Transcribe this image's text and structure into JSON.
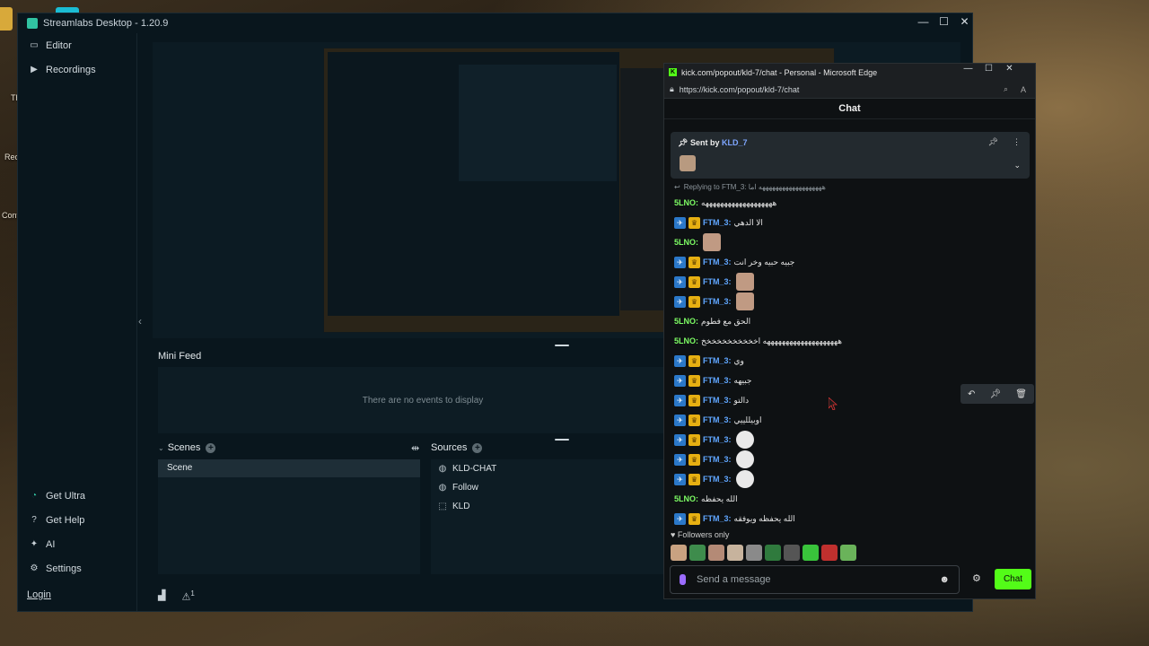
{
  "desktop": {
    "labels": [
      "Th",
      "Rec",
      "Cont"
    ]
  },
  "streamlabs": {
    "title": "Streamlabs Desktop - 1.20.9",
    "nav_top": [
      {
        "label": "Editor",
        "icon": "monitor-icon"
      },
      {
        "label": "Recordings",
        "icon": "play-circle-icon"
      }
    ],
    "nav_bottom": [
      {
        "label": "Get Ultra",
        "icon": "ultra-icon"
      },
      {
        "label": "Get Help",
        "icon": "help-icon"
      },
      {
        "label": "AI",
        "icon": "sparkle-icon"
      },
      {
        "label": "Settings",
        "icon": "gear-icon"
      }
    ],
    "login": "Login",
    "mini_feed": {
      "title": "Mini Feed",
      "empty": "There are no events to display"
    },
    "scenes": {
      "title": "Scenes",
      "items": [
        "Scene"
      ]
    },
    "sources": {
      "title": "Sources",
      "items": [
        {
          "label": "KLD-CHAT",
          "icon": "globe-icon"
        },
        {
          "label": "Follow",
          "icon": "globe-icon"
        },
        {
          "label": "KLD",
          "icon": "capture-icon"
        }
      ]
    },
    "footer": {
      "alert_count": "1"
    }
  },
  "edge": {
    "title": "kick.com/popout/kld-7/chat - Personal - Microsoft Edge",
    "url": "https://kick.com/popout/kld-7/chat",
    "chat_title": "Chat",
    "pinned": {
      "prefix": "Sent by",
      "user": "KLD_7"
    },
    "reply_to": "Replying to FTM_3: هههههههههههههههههههه اما",
    "messages": [
      {
        "user": "5LNO:",
        "color": "green",
        "badges": false,
        "text": "هههههههههههههههههههه",
        "emote": ""
      },
      {
        "user": "FTM_3:",
        "color": "blue",
        "badges": true,
        "text": "الا الدهي",
        "emote": ""
      },
      {
        "user": "5LNO:",
        "color": "green",
        "badges": false,
        "text": "",
        "emote": "square"
      },
      {
        "user": "FTM_3:",
        "color": "blue",
        "badges": true,
        "text": "جبيه حبيه وخر انت",
        "emote": ""
      },
      {
        "user": "FTM_3:",
        "color": "blue",
        "badges": true,
        "text": "",
        "emote": "square"
      },
      {
        "user": "FTM_3:",
        "color": "blue",
        "badges": true,
        "text": "",
        "emote": "square"
      },
      {
        "user": "5LNO:",
        "color": "green",
        "badges": false,
        "text": "الحق مع فطوم",
        "emote": ""
      },
      {
        "user": "5LNO:",
        "color": "green",
        "badges": false,
        "text": "ههههههههههههههههههههه اخخخخخخخخخخخ",
        "emote": ""
      },
      {
        "user": "FTM_3:",
        "color": "blue",
        "badges": true,
        "text": "وي",
        "emote": ""
      },
      {
        "user": "FTM_3:",
        "color": "blue",
        "badges": true,
        "text": "جبيهه",
        "emote": ""
      },
      {
        "user": "FTM_3:",
        "color": "blue",
        "badges": true,
        "text": "دالتو",
        "emote": ""
      },
      {
        "user": "FTM_3:",
        "color": "blue",
        "badges": true,
        "text": "اوبيللييي",
        "emote": ""
      },
      {
        "user": "FTM_3:",
        "color": "blue",
        "badges": true,
        "text": "",
        "emote": "round"
      },
      {
        "user": "FTM_3:",
        "color": "blue",
        "badges": true,
        "text": "",
        "emote": "round"
      },
      {
        "user": "FTM_3:",
        "color": "blue",
        "badges": true,
        "text": "",
        "emote": "round"
      },
      {
        "user": "5LNO:",
        "color": "green",
        "badges": false,
        "text": "الله يحفظه",
        "emote": ""
      },
      {
        "user": "FTM_3:",
        "color": "blue",
        "badges": true,
        "text": "الله يحفظه ويوفقه",
        "emote": ""
      }
    ],
    "followers_only": "Followers only",
    "input_placeholder": "Send a message",
    "chat_button": "Chat"
  }
}
